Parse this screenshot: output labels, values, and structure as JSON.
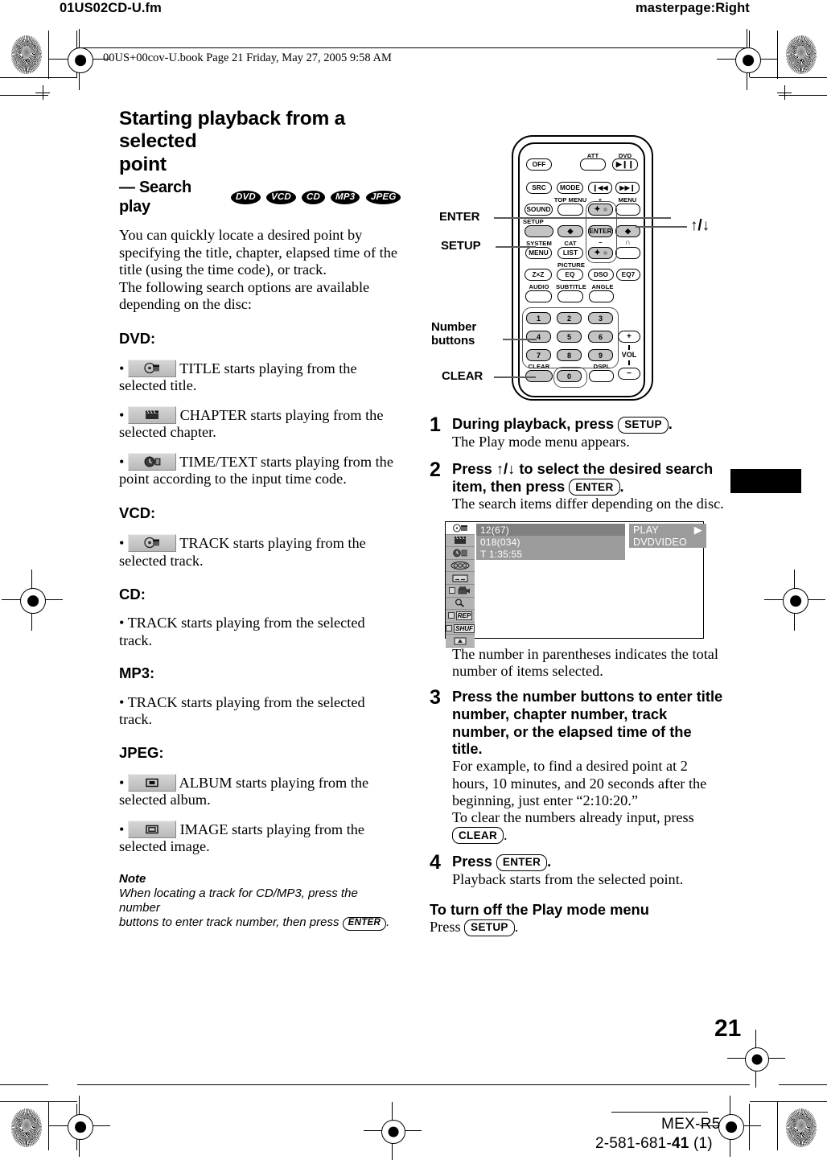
{
  "page": {
    "header_left": "01US02CD-U.fm",
    "header_right": "masterpage:Right",
    "book_line": "00US+00cov-U.book  Page 21  Friday, May 27, 2005  9:58 AM",
    "folio": "21",
    "model": "MEX-R5",
    "part_number_prefix": "2-581-681-",
    "part_number_bold": "41",
    "part_number_suffix": " (1)"
  },
  "article": {
    "title_line1": "Starting playback from a selected",
    "title_line2": "point",
    "subtitle_prefix": "— Search play",
    "disc_badges": [
      "DVD",
      "VCD",
      "CD",
      "MP3",
      "JPEG"
    ],
    "intro": "You can quickly locate a desired point by specifying the title, chapter, elapsed time of the title (using the time code), or track.\nThe following search options are available depending on the disc:",
    "intro_lines": [
      "You can quickly locate a desired point by",
      "specifying the title, chapter, elapsed time of the",
      "title (using the time code), or track.",
      "The following search options are available",
      "depending on the disc:"
    ],
    "sections": [
      {
        "heading": "DVD:",
        "items": [
          {
            "icon": "title-disc-icon",
            "has_icon": true,
            "lines": [
              "TITLE starts playing from the",
              "selected title."
            ]
          },
          {
            "icon": "chapter-clapperboard-icon",
            "has_icon": true,
            "lines": [
              "CHAPTER starts playing from the",
              "selected chapter."
            ]
          },
          {
            "icon": "time-text-clock-icon",
            "has_icon": true,
            "lines": [
              "TIME/TEXT starts playing from the",
              "point according to the input time code."
            ]
          }
        ]
      },
      {
        "heading": "VCD:",
        "items": [
          {
            "icon": "track-disc-icon",
            "has_icon": true,
            "lines": [
              "TRACK starts playing from the",
              "selected track."
            ]
          }
        ]
      },
      {
        "heading": "CD:",
        "items": [
          {
            "icon": null,
            "has_icon": false,
            "lines": [
              "• TRACK starts playing from the selected track."
            ]
          }
        ]
      },
      {
        "heading": "MP3:",
        "items": [
          {
            "icon": null,
            "has_icon": false,
            "lines": [
              "• TRACK starts playing from the selected track."
            ]
          }
        ]
      },
      {
        "heading": "JPEG:",
        "items": [
          {
            "icon": "album-icon",
            "has_icon": true,
            "lines": [
              "ALBUM starts playing from the",
              "selected album."
            ]
          },
          {
            "icon": "image-icon",
            "has_icon": true,
            "lines": [
              "IMAGE starts playing from the",
              "selected image."
            ]
          }
        ]
      }
    ],
    "note": {
      "heading": "Note",
      "line1": "When locating a track for CD/MP3, press the number",
      "line2_pre": "buttons to enter track number, then press ",
      "line2_key": "ENTER",
      "line2_post": "."
    }
  },
  "remote": {
    "callouts": {
      "enter": "ENTER",
      "setup": "SETUP",
      "number_buttons": "Number\nbuttons",
      "clear": "CLEAR",
      "updown": "↑/↓"
    },
    "buttons": {
      "off": "OFF",
      "att_label": "ATT",
      "dvd_label": "DVD",
      "dvd_play": "▶❙❙",
      "src": "SRC",
      "mode": "MODE",
      "prev": "❙◀◀",
      "next": "▶▶❙",
      "topmenu_label": "TOP MENU",
      "menu_label": "MENU",
      "sound": "SOUND",
      "setup_label": "SETUP",
      "plus_label": "+",
      "minus_label": "−",
      "enter": "ENTER",
      "left_arrow": "◆",
      "right_arrow": "◆",
      "up_arrow": "✦",
      "down_arrow": "✦",
      "system_label": "SYSTEM",
      "system_menu": "MENU",
      "cat_label": "CAT",
      "list": "LIST",
      "headphone_label": "∩",
      "picture_label": "PICTURE",
      "zxz": "Z×Z",
      "eq": "EQ",
      "dso": "DSO",
      "eq7": "EQ7",
      "audio_label": "AUDIO",
      "subtitle_label": "SUBTITLE",
      "angle_label": "ANGLE",
      "numbers": [
        "1",
        "2",
        "3",
        "4",
        "5",
        "6",
        "7",
        "8",
        "9"
      ],
      "zero": "0",
      "clear_label": "CLEAR",
      "dspl_label": "DSPL",
      "vol_plus": "+",
      "vol_label": "VOL",
      "vol_minus": "−"
    }
  },
  "steps": [
    {
      "num": "1",
      "bold_pre": "During playback, press ",
      "bold_key": "SETUP",
      "bold_post": ".",
      "body_lines": [
        "The Play mode menu appears."
      ]
    },
    {
      "num": "2",
      "bold_line1": "Press ↑/↓ to select the desired search",
      "bold_line2_pre": "item, then press ",
      "bold_key": "ENTER",
      "bold_post": ".",
      "body_lines": [
        "The search items differ depending on the disc."
      ]
    },
    {
      "num": "3",
      "bold_lines": [
        "Press the number buttons to enter title",
        "number, chapter number, track",
        "number, or the elapsed time of the",
        "title."
      ],
      "body_lines": [
        "For example, to find a desired point at 2",
        "hours, 10 minutes, and 20 seconds after the",
        "beginning, just enter “2:10:20.”",
        "To clear the numbers already input, press"
      ],
      "body_key": "CLEAR",
      "body_key_post": "."
    },
    {
      "num": "4",
      "bold_pre": "Press ",
      "bold_key": "ENTER",
      "bold_post": ".",
      "body_lines": [
        "Playback starts from the selected point."
      ]
    }
  ],
  "osd": {
    "caption_lines": [
      "The number in parentheses indicates the total",
      "number of items selected."
    ],
    "rows": [
      {
        "text": "12(67)",
        "highlighted": true
      },
      {
        "text": "018(034)",
        "highlighted": false
      },
      {
        "text": "T  1:35:55",
        "highlighted": false
      }
    ],
    "status_play": "PLAY",
    "status_play_icon": "▶",
    "status_format": "DVDVIDEO",
    "icon_column": [
      "title-disc-icon",
      "chapter-clapperboard-icon",
      "time-clock-icon",
      "audio-icon",
      "subtitle-icon",
      "angle-camera-icon",
      "search-magnifier-icon",
      "repeat-icon",
      "shuffle-icon",
      "brightness-icon"
    ],
    "repeat_label": "REP",
    "shuffle_label": "SHUF"
  },
  "closing": {
    "heading": "To turn off the Play mode menu",
    "body_pre": "Press ",
    "body_key": "SETUP",
    "body_post": "."
  }
}
